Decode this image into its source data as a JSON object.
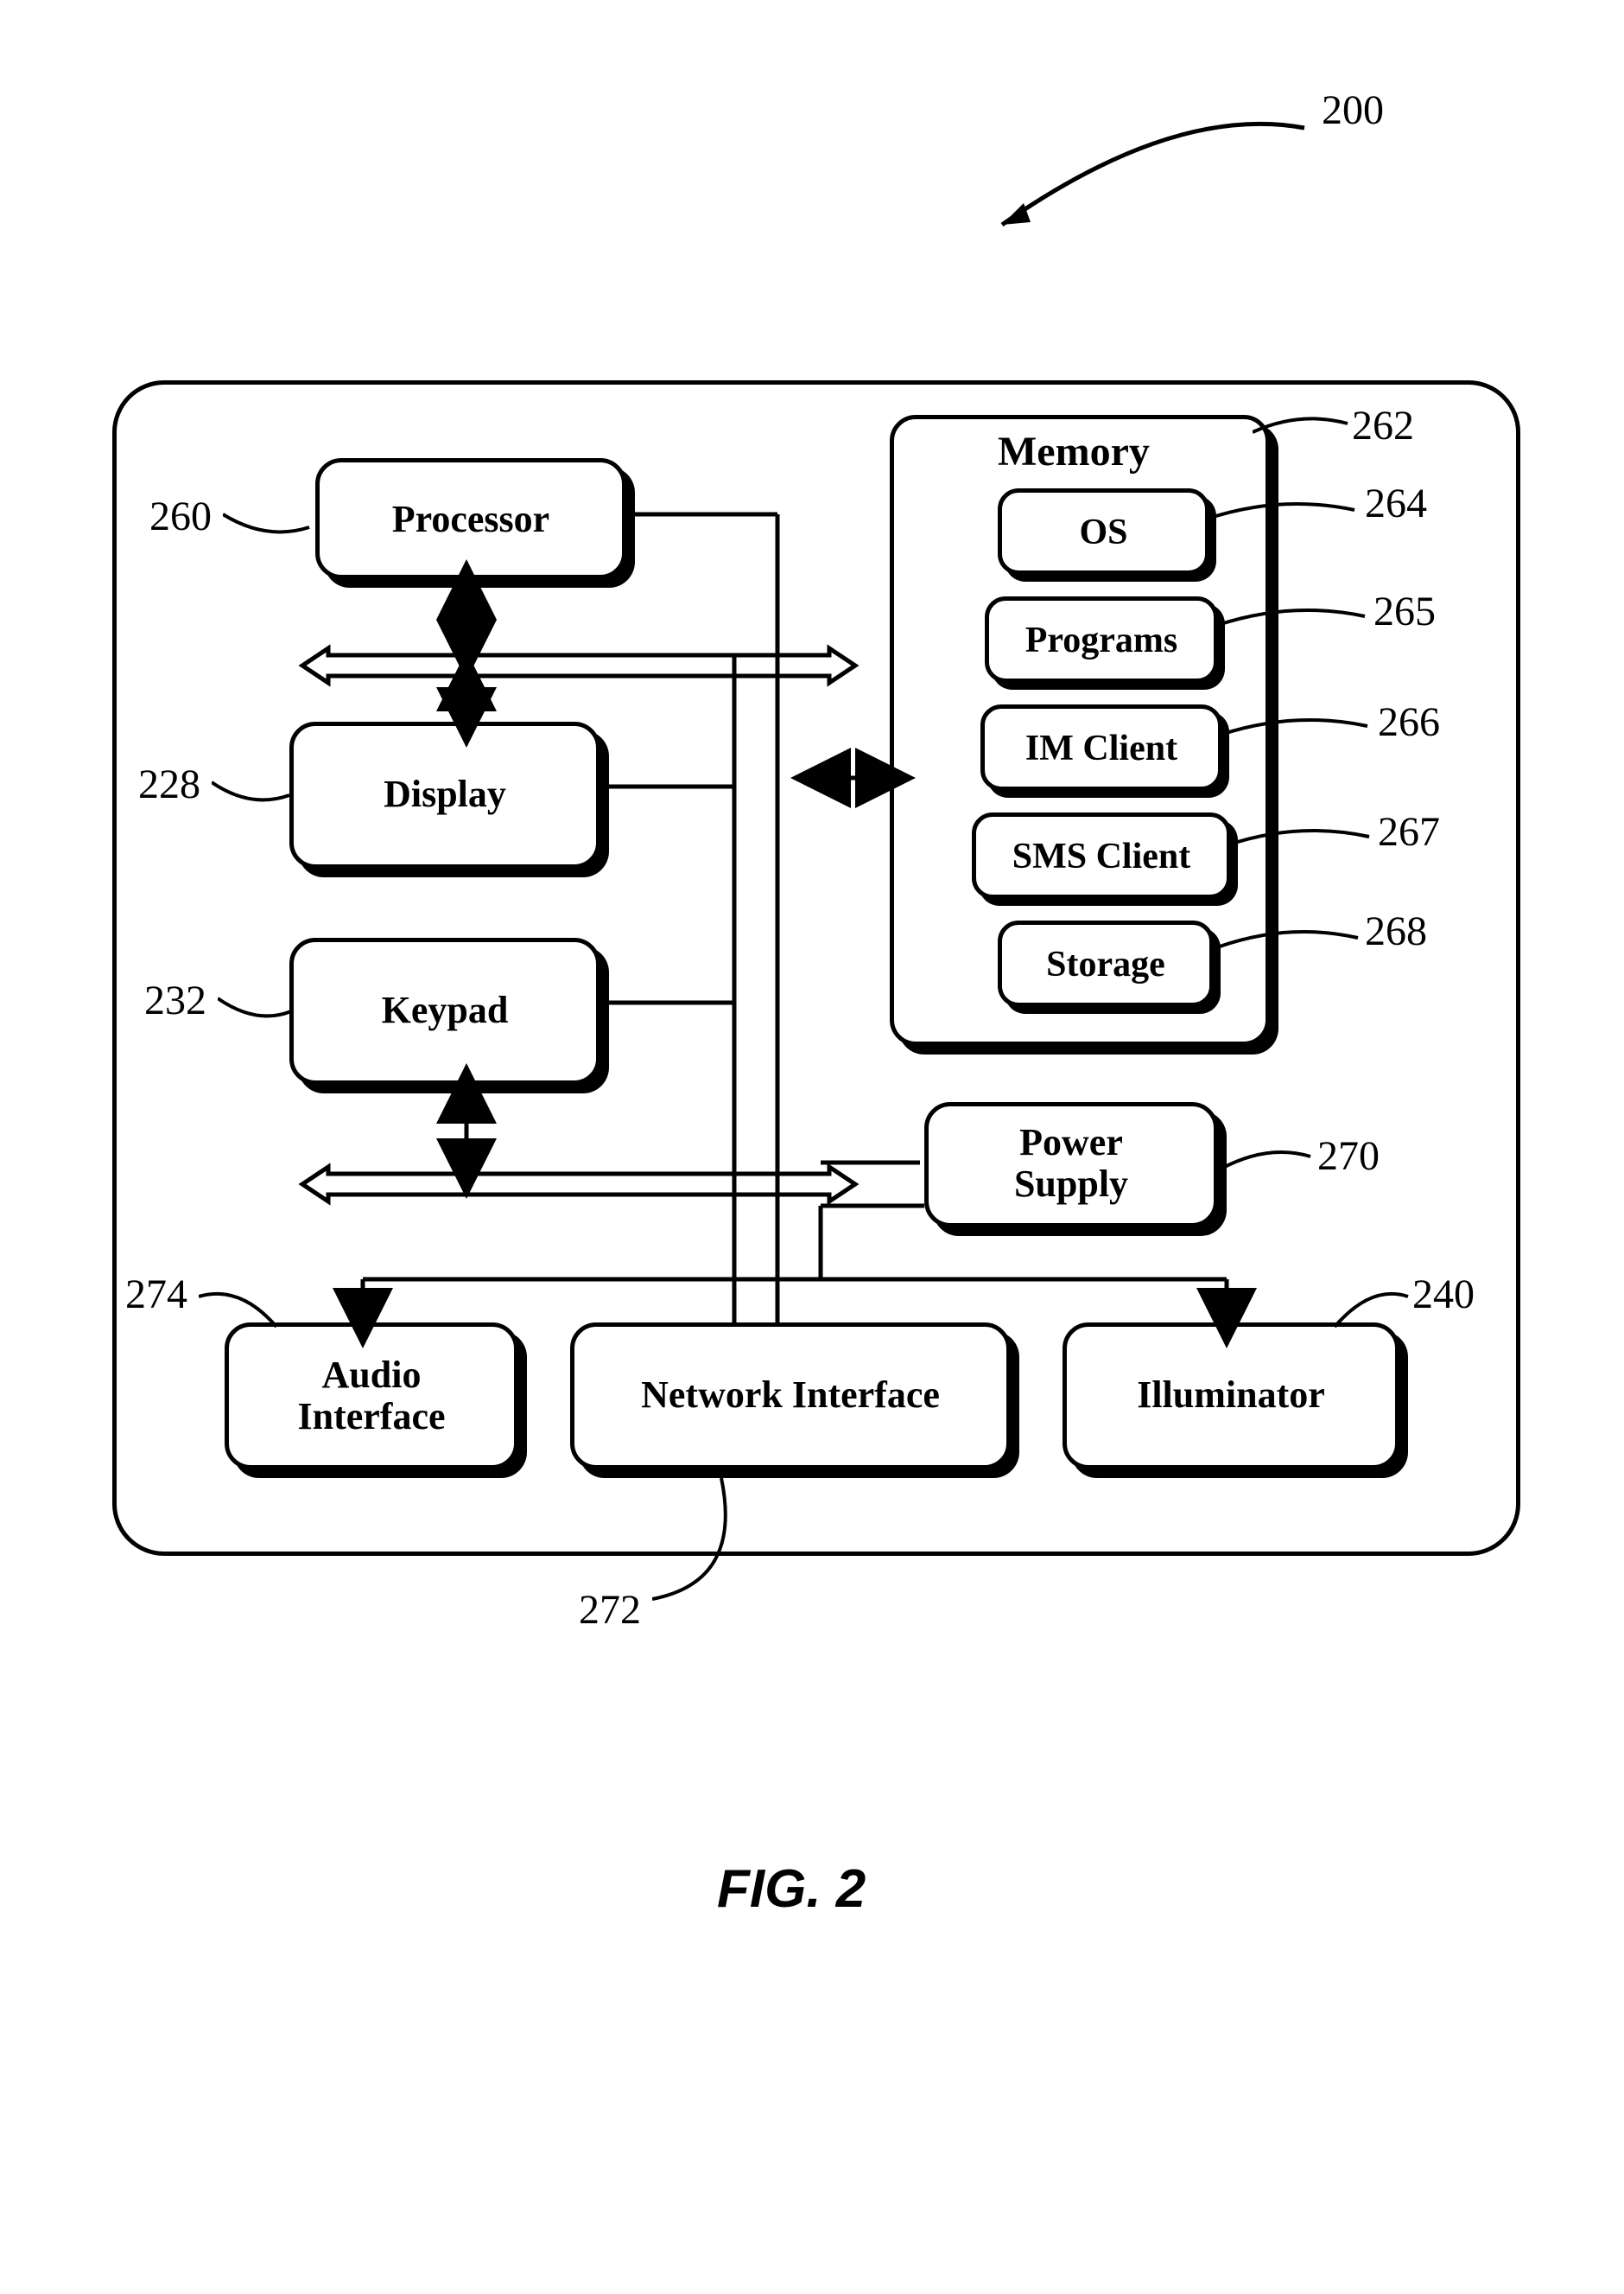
{
  "figure": {
    "ref_main": "200",
    "caption": "FIG. 2"
  },
  "blocks": {
    "processor": {
      "label": "Processor",
      "ref": "260"
    },
    "display": {
      "label": "Display",
      "ref": "228"
    },
    "keypad": {
      "label": "Keypad",
      "ref": "232"
    },
    "audio_interface": {
      "label": "Audio\nInterface",
      "ref": "274"
    },
    "network_interface": {
      "label": "Network Interface",
      "ref": "272"
    },
    "illuminator": {
      "label": "Illuminator",
      "ref": "240"
    },
    "power_supply": {
      "label": "Power\nSupply",
      "ref": "270"
    },
    "memory": {
      "title": "Memory",
      "ref": "262",
      "items": {
        "os": {
          "label": "OS",
          "ref": "264"
        },
        "programs": {
          "label": "Programs",
          "ref": "265"
        },
        "im_client": {
          "label": "IM Client",
          "ref": "266"
        },
        "sms_client": {
          "label": "SMS Client",
          "ref": "267"
        },
        "storage": {
          "label": "Storage",
          "ref": "268"
        }
      }
    }
  }
}
